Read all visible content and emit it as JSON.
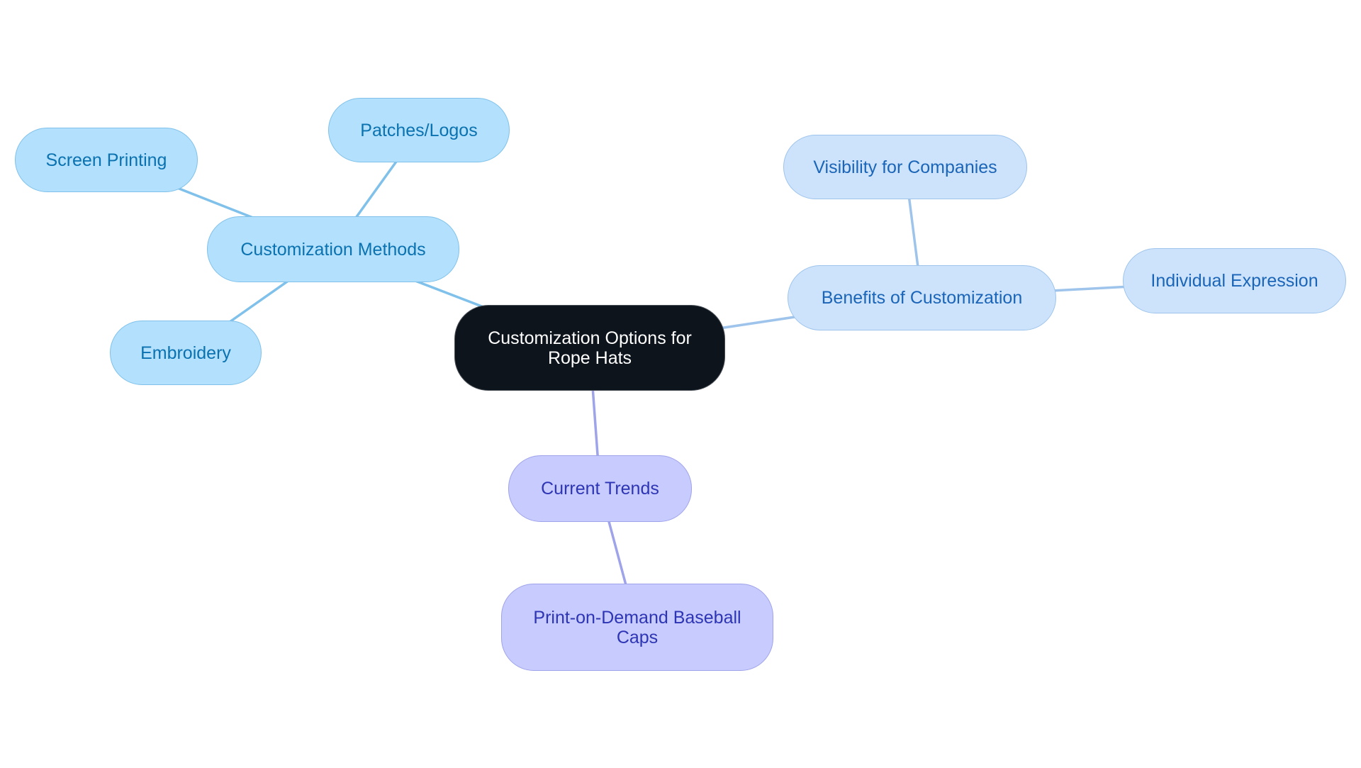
{
  "diagram": {
    "type": "mindmap",
    "root": {
      "id": "root",
      "label": "Customization Options for Rope Hats"
    },
    "branches": [
      {
        "id": "methods",
        "label": "Customization Methods",
        "color": "#7fc1ea",
        "children": [
          {
            "id": "screen",
            "label": "Screen Printing"
          },
          {
            "id": "patches",
            "label": "Patches/Logos"
          },
          {
            "id": "embroidery",
            "label": "Embroidery"
          }
        ]
      },
      {
        "id": "benefits",
        "label": "Benefits of Customization",
        "color": "#9ec4ec",
        "children": [
          {
            "id": "visibility",
            "label": "Visibility for Companies"
          },
          {
            "id": "individual",
            "label": "Individual Expression"
          }
        ]
      },
      {
        "id": "trends",
        "label": "Current Trends",
        "color": "#9ea3ea",
        "children": [
          {
            "id": "pod",
            "label": "Print-on-Demand Baseball Caps"
          }
        ]
      }
    ]
  },
  "colors": {
    "root_fill": "#0d141c",
    "methods_fill": "#b3e0fd",
    "methods_text": "#0a72b0",
    "benefits_fill": "#cde3fb",
    "benefits_text": "#1b65b8",
    "trends_fill": "#c7cbfd",
    "trends_text": "#2e35b5"
  }
}
